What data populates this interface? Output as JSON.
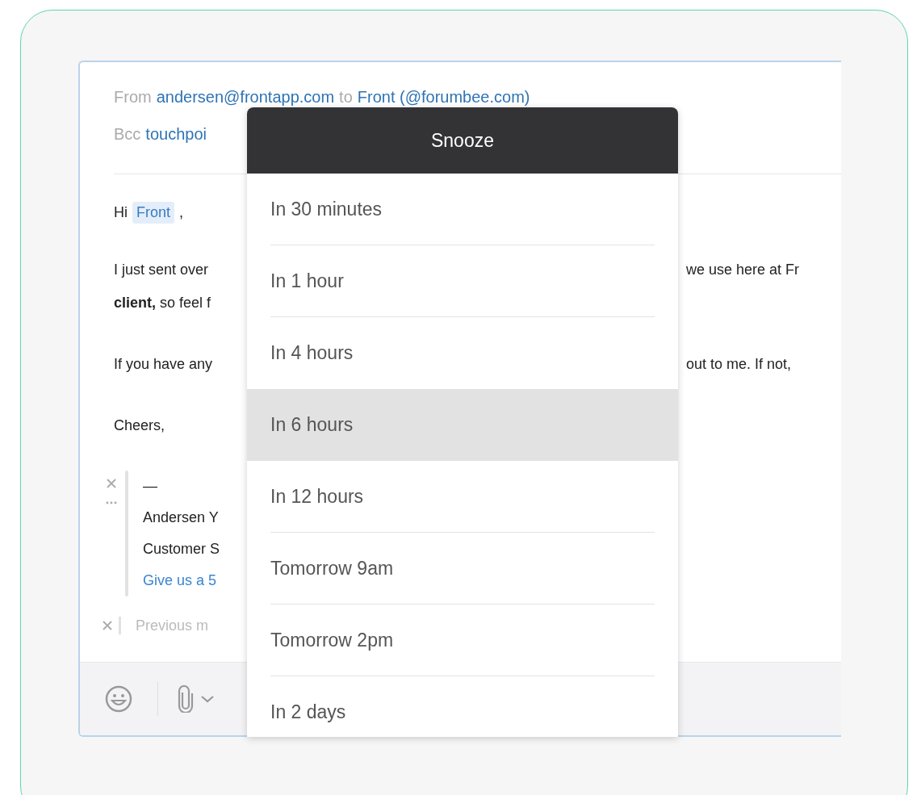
{
  "email": {
    "from_line": {
      "label": "From",
      "address": "andersen@frontapp.com",
      "connector": "to",
      "recipient": "Front (@forumbee.com)"
    },
    "bcc_line": {
      "label": "Bcc",
      "address": "touchpoi"
    },
    "greeting": {
      "text": "Hi",
      "mention": "Front",
      "punct": ","
    },
    "paragraphs": [
      {
        "lines": [
          {
            "left": "I just sent over",
            "right": "we use here at Fr"
          },
          {
            "left": "**client,** so feel f"
          }
        ]
      },
      {
        "lines": [
          {
            "left": "If you have any",
            "right": "out to me. If not,"
          }
        ]
      },
      {
        "lines": [
          {
            "left": "Cheers,"
          }
        ]
      }
    ],
    "signature": [
      {
        "kind": "plain",
        "text": "—"
      },
      {
        "kind": "plain",
        "text": "Andersen Y"
      },
      {
        "kind": "plain",
        "text": "Customer S"
      },
      {
        "kind": "link",
        "text": "Give us a 5"
      }
    ],
    "quoted": {
      "text": "Previous m"
    }
  },
  "snooze_menu": {
    "title": "Snooze",
    "items": [
      {
        "label": "In 30 minutes",
        "selected": false
      },
      {
        "label": "In 1 hour",
        "selected": false
      },
      {
        "label": "In 4 hours",
        "selected": false
      },
      {
        "label": "In 6 hours",
        "selected": true
      },
      {
        "label": "In 12 hours",
        "selected": false
      },
      {
        "label": "Tomorrow 9am",
        "selected": false
      },
      {
        "label": "Tomorrow 2pm",
        "selected": false
      },
      {
        "label": "In 2 days",
        "selected": false
      }
    ]
  }
}
